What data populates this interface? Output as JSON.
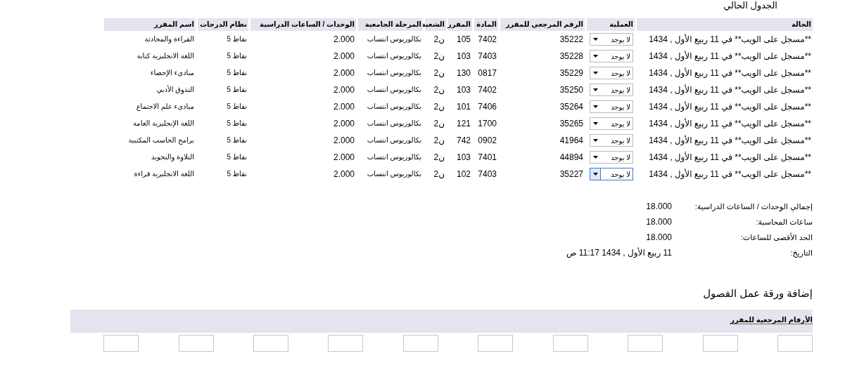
{
  "page_title": "الجدول الحالي",
  "table": {
    "columns": [
      "الحالة",
      "العملية",
      "الرقم المرجعي للمقرر",
      "المادة",
      "المقرر",
      "الشعبة",
      "المرحلة الجامعية",
      "الوحدات / الساعات الدراسية",
      "نظام الدرجات",
      "اسم المقرر"
    ],
    "rows": [
      {
        "status": "**مسجل على الويب** في 11 ربيع الأول , 1434",
        "action": "لا يوجد",
        "focused": false,
        "ref": "35222",
        "subject": "7402",
        "course": "105",
        "section": "ن2",
        "level": "بكالوريوس انتساب",
        "units": "2.000",
        "grading": "نقاط 5",
        "name": "القراءة والمحادثة"
      },
      {
        "status": "**مسجل على الويب** في 11 ربيع الأول , 1434",
        "action": "لا يوجد",
        "focused": false,
        "ref": "35228",
        "subject": "7403",
        "course": "103",
        "section": "ن2",
        "level": "بكالوريوس انتساب",
        "units": "2.000",
        "grading": "نقاط 5",
        "name": "اللغة الانجليزية كتابة"
      },
      {
        "status": "**مسجل على الويب** في 11 ربيع الأول , 1434",
        "action": "لا يوجد",
        "focused": false,
        "ref": "35229",
        "subject": "0817",
        "course": "130",
        "section": "ن2",
        "level": "بكالوريوس انتساب",
        "units": "2.000",
        "grading": "نقاط 5",
        "name": "مبادىء الإحصاء"
      },
      {
        "status": "**مسجل على الويب** في 11 ربيع الأول , 1434",
        "action": "لا يوجد",
        "focused": false,
        "ref": "35250",
        "subject": "7402",
        "course": "103",
        "section": "ن2",
        "level": "بكالوريوس انتساب",
        "units": "2.000",
        "grading": "نقاط 5",
        "name": "التذوق الأدبي"
      },
      {
        "status": "**مسجل على الويب** في 11 ربيع الأول , 1434",
        "action": "لا يوجد",
        "focused": false,
        "ref": "35264",
        "subject": "7406",
        "course": "101",
        "section": "ن2",
        "level": "بكالوريوس انتساب",
        "units": "2.000",
        "grading": "نقاط 5",
        "name": "مبادىء علم الاجتماع"
      },
      {
        "status": "**مسجل على الويب** في 11 ربيع الأول , 1434",
        "action": "لا يوجد",
        "focused": false,
        "ref": "35265",
        "subject": "1700",
        "course": "121",
        "section": "ن2",
        "level": "بكالوريوس انتساب",
        "units": "2.000",
        "grading": "نقاط 5",
        "name": "اللغة الإنجليزية العامة"
      },
      {
        "status": "**مسجل على الويب** في 11 ربيع الأول , 1434",
        "action": "لا يوجد",
        "focused": false,
        "ref": "41964",
        "subject": "0902",
        "course": "742",
        "section": "ن2",
        "level": "بكالوريوس انتساب",
        "units": "2.000",
        "grading": "نقاط 5",
        "name": "برامج الحاسب المكتبية"
      },
      {
        "status": "**مسجل على الويب** في 11 ربيع الأول , 1434",
        "action": "لا يوجد",
        "focused": false,
        "ref": "44894",
        "subject": "7401",
        "course": "103",
        "section": "ن2",
        "level": "بكالوريوس انتساب",
        "units": "2.000",
        "grading": "نقاط 5",
        "name": "التلاوة والتجويد"
      },
      {
        "status": "**مسجل على الويب** في 11 ربيع الأول , 1434",
        "action": "لا يوجد",
        "focused": true,
        "ref": "35227",
        "subject": "7403",
        "course": "102",
        "section": "ن2",
        "level": "بكالوريوس انتساب",
        "units": "2.000",
        "grading": "نقاط 5",
        "name": "اللغة الانجليزية قراءة"
      }
    ]
  },
  "summary": [
    {
      "label": "إجمالي الوحدات / الساعات الدراسية:",
      "value": "18.000"
    },
    {
      "label": "ساعات المحاسبة:",
      "value": "18.000"
    },
    {
      "label": "الحد الأقصى للساعات:",
      "value": "18.000"
    },
    {
      "label": "التاريخ:",
      "value": "11 ربيع الأول , 1434 11:17 ص"
    }
  ],
  "add_section": {
    "title": "إضافة ورقة عمل الفصول",
    "bar_label": "الأرقام المرجعية للمقرر",
    "inputs": [
      {
        "kind": "text"
      },
      {
        "kind": "text"
      },
      {
        "kind": "text"
      },
      {
        "kind": "text"
      },
      {
        "kind": "text"
      },
      {
        "kind": "text"
      },
      {
        "kind": "text"
      },
      {
        "kind": "text"
      },
      {
        "kind": "text"
      },
      {
        "kind": "text"
      }
    ]
  }
}
